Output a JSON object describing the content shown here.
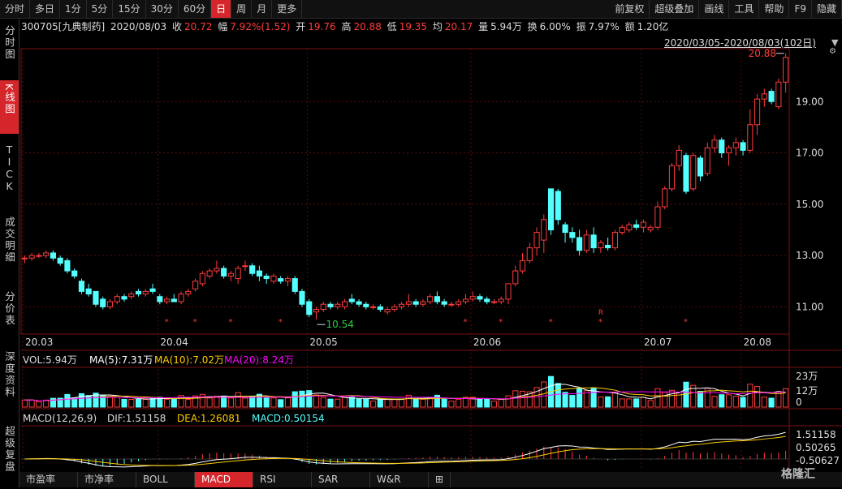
{
  "toolbar": {
    "left": [
      "分时",
      "多日",
      "1分",
      "5分",
      "15分",
      "30分",
      "60分",
      "日",
      "周",
      "月",
      "更多"
    ],
    "active": "日",
    "right": [
      "前复权",
      "超级叠加",
      "画线",
      "工具",
      "帮助",
      "F9",
      "隐藏"
    ]
  },
  "sidebar": {
    "items": [
      "分时图",
      "K线图",
      "TICK",
      "成交明细",
      "分价表",
      "深度资料",
      "超级复盘"
    ],
    "active": "K线图"
  },
  "info": {
    "code": "300705[九典制药]",
    "date": "2020/08/03",
    "close_label": "收",
    "close": "20.72",
    "chg_label": "幅",
    "chg": "7.92%(1.52)",
    "open_label": "开",
    "open": "19.76",
    "high_label": "高",
    "high": "20.88",
    "low_label": "低",
    "low": "19.35",
    "avg_label": "均",
    "avg": "20.17",
    "vol_label": "量",
    "vol": "5.94万",
    "turn_label": "换",
    "turn": "6.00%",
    "amp_label": "振",
    "amp": "7.97%",
    "amt_label": "额",
    "amt": "1.20亿"
  },
  "range": "2020/03/05-2020/08/03(102日)",
  "main_chart": {
    "type": "candlestick",
    "y_ticks": [
      "19.00",
      "17.00",
      "15.00",
      "13.00",
      "11.00"
    ],
    "x_ticks": [
      "20.03",
      "20.04",
      "20.05",
      "20.06",
      "20.07",
      "20.08"
    ],
    "high_label": "20.88",
    "low_label": "10.54",
    "r_marker": "R"
  },
  "vol_legend": {
    "name": "VOL:5.94万",
    "ma5": "MA(5):7.31万",
    "ma10": "MA(10):7.02万",
    "ma20": "MA(20):8.24万"
  },
  "vol_axis": [
    "23万",
    "12万",
    "0"
  ],
  "macd_legend": {
    "name": "MACD(12,26,9)",
    "dif": "DIF:1.51158",
    "dea": "DEA:1.26081",
    "macd": "MACD:0.50154"
  },
  "macd_axis": [
    "1.51158",
    "0.50265",
    "-0.50627"
  ],
  "bottom_tabs": [
    "市盈率",
    "市净率",
    "BOLL",
    "MACD",
    "RSI",
    "SAR",
    "W&R"
  ],
  "bottom_active": "MACD",
  "logo": "格隆汇",
  "colors": {
    "up": "#ff3b3b",
    "down": "#54ffff",
    "ma5": "#ffffff",
    "ma10": "#ffcc00",
    "ma20": "#ff00ff",
    "accent": "#d4262b"
  },
  "chart_data": {
    "type": "candlestick",
    "ohlc": [
      [
        12.9,
        13.0,
        12.7,
        12.9
      ],
      [
        12.9,
        13.1,
        12.8,
        13.0
      ],
      [
        13.0,
        13.1,
        12.9,
        13.0
      ],
      [
        13.0,
        13.2,
        12.9,
        13.1
      ],
      [
        13.1,
        13.2,
        12.8,
        12.9
      ],
      [
        12.9,
        13.0,
        12.6,
        12.7
      ],
      [
        12.8,
        12.9,
        12.3,
        12.4
      ],
      [
        12.4,
        12.5,
        12.1,
        12.2
      ],
      [
        12.0,
        12.1,
        11.5,
        11.6
      ],
      [
        11.7,
        11.9,
        11.4,
        11.5
      ],
      [
        11.6,
        11.6,
        11.0,
        11.1
      ],
      [
        11.3,
        11.4,
        10.9,
        11.0
      ],
      [
        11.0,
        11.3,
        10.9,
        11.2
      ],
      [
        11.2,
        11.5,
        11.1,
        11.4
      ],
      [
        11.4,
        11.5,
        11.2,
        11.3
      ],
      [
        11.4,
        11.6,
        11.3,
        11.5
      ],
      [
        11.6,
        11.7,
        11.4,
        11.5
      ],
      [
        11.5,
        11.7,
        11.4,
        11.6
      ],
      [
        11.7,
        11.9,
        11.5,
        11.6
      ],
      [
        11.4,
        11.5,
        11.1,
        11.2
      ],
      [
        11.2,
        11.4,
        11.1,
        11.3
      ],
      [
        11.3,
        11.5,
        11.2,
        11.2
      ],
      [
        11.2,
        11.6,
        11.1,
        11.5
      ],
      [
        11.5,
        11.7,
        11.4,
        11.6
      ],
      [
        11.7,
        12.1,
        11.6,
        12.0
      ],
      [
        11.9,
        12.4,
        11.8,
        12.3
      ],
      [
        12.2,
        12.5,
        12.1,
        12.4
      ],
      [
        12.4,
        12.8,
        12.3,
        12.5
      ],
      [
        12.5,
        12.6,
        12.1,
        12.2
      ],
      [
        12.2,
        12.4,
        12.0,
        12.3
      ],
      [
        12.1,
        12.6,
        11.9,
        12.5
      ],
      [
        12.6,
        12.8,
        12.4,
        12.6
      ],
      [
        12.6,
        12.7,
        12.2,
        12.3
      ],
      [
        12.4,
        12.6,
        12.0,
        12.2
      ],
      [
        12.2,
        12.3,
        11.9,
        12.1
      ],
      [
        12.0,
        12.3,
        11.9,
        12.2
      ],
      [
        12.1,
        12.2,
        11.9,
        12.0
      ],
      [
        12.0,
        12.2,
        11.8,
        12.1
      ],
      [
        12.1,
        12.2,
        11.5,
        11.6
      ],
      [
        11.6,
        11.7,
        11.0,
        11.1
      ],
      [
        11.2,
        11.3,
        10.6,
        10.7
      ],
      [
        10.8,
        11.0,
        10.5,
        10.9
      ],
      [
        10.9,
        11.2,
        10.8,
        11.1
      ],
      [
        11.1,
        11.2,
        10.9,
        11.0
      ],
      [
        11.0,
        11.2,
        10.9,
        11.1
      ],
      [
        11.0,
        11.3,
        10.9,
        11.2
      ],
      [
        11.3,
        11.5,
        11.1,
        11.2
      ],
      [
        11.2,
        11.3,
        11.0,
        11.1
      ],
      [
        11.1,
        11.2,
        10.9,
        11.0
      ],
      [
        11.0,
        11.1,
        10.9,
        11.0
      ],
      [
        11.0,
        11.1,
        10.8,
        10.9
      ],
      [
        10.8,
        11.0,
        10.7,
        10.9
      ],
      [
        10.9,
        11.1,
        10.8,
        11.0
      ],
      [
        11.0,
        11.2,
        10.9,
        11.1
      ],
      [
        11.1,
        11.5,
        11.0,
        11.2
      ],
      [
        11.2,
        11.3,
        11.0,
        11.1
      ],
      [
        11.1,
        11.3,
        11.0,
        11.2
      ],
      [
        11.2,
        11.5,
        11.1,
        11.4
      ],
      [
        11.4,
        11.6,
        11.1,
        11.2
      ],
      [
        11.2,
        11.3,
        11.0,
        11.1
      ],
      [
        11.1,
        11.2,
        11.0,
        11.1
      ],
      [
        11.1,
        11.3,
        11.0,
        11.2
      ],
      [
        11.2,
        11.5,
        11.1,
        11.3
      ],
      [
        11.3,
        11.6,
        11.2,
        11.4
      ],
      [
        11.4,
        11.5,
        11.2,
        11.3
      ],
      [
        11.3,
        11.4,
        11.1,
        11.2
      ],
      [
        11.2,
        11.3,
        11.1,
        11.2
      ],
      [
        11.2,
        11.4,
        11.1,
        11.3
      ],
      [
        11.3,
        11.6,
        11.1,
        11.9
      ],
      [
        11.9,
        12.6,
        11.8,
        12.4
      ],
      [
        12.4,
        13.1,
        12.3,
        12.8
      ],
      [
        12.8,
        13.5,
        12.7,
        13.3
      ],
      [
        13.3,
        14.1,
        13.0,
        13.9
      ],
      [
        13.6,
        14.6,
        13.1,
        14.4
      ],
      [
        15.6,
        15.6,
        13.8,
        14.0
      ],
      [
        15.5,
        15.6,
        14.2,
        14.4
      ],
      [
        14.2,
        14.3,
        13.5,
        13.9
      ],
      [
        13.9,
        14.1,
        13.5,
        13.7
      ],
      [
        13.7,
        14.0,
        13.0,
        13.2
      ],
      [
        13.2,
        14.0,
        13.1,
        13.8
      ],
      [
        13.8,
        14.1,
        13.1,
        13.3
      ],
      [
        13.3,
        13.6,
        13.1,
        13.5
      ],
      [
        13.4,
        13.7,
        13.2,
        13.3
      ],
      [
        13.3,
        14.0,
        13.2,
        13.9
      ],
      [
        13.9,
        14.2,
        13.8,
        14.1
      ],
      [
        14.0,
        14.3,
        13.9,
        14.2
      ],
      [
        14.2,
        14.4,
        14.0,
        14.1
      ],
      [
        14.1,
        14.4,
        13.9,
        14.3
      ],
      [
        14.0,
        14.2,
        13.9,
        14.1
      ],
      [
        14.1,
        15.1,
        14.0,
        14.9
      ],
      [
        14.9,
        15.7,
        14.8,
        15.6
      ],
      [
        15.6,
        16.6,
        15.5,
        16.5
      ],
      [
        16.5,
        17.3,
        16.3,
        17.1
      ],
      [
        16.9,
        17.0,
        15.4,
        15.5
      ],
      [
        15.6,
        17.0,
        15.5,
        16.9
      ],
      [
        16.8,
        16.9,
        15.9,
        16.1
      ],
      [
        16.2,
        17.4,
        16.1,
        17.2
      ],
      [
        17.2,
        17.7,
        17.0,
        17.5
      ],
      [
        17.5,
        17.6,
        16.8,
        17.0
      ],
      [
        17.0,
        17.3,
        16.5,
        17.2
      ],
      [
        17.2,
        17.6,
        16.9,
        17.4
      ],
      [
        17.4,
        17.5,
        16.9,
        17.1
      ],
      [
        17.1,
        18.7,
        17.0,
        18.1
      ],
      [
        18.1,
        19.3,
        17.7,
        19.1
      ],
      [
        19.1,
        19.5,
        18.8,
        19.3
      ],
      [
        19.4,
        19.5,
        18.9,
        19.0
      ],
      [
        18.8,
        19.9,
        18.7,
        19.76
      ],
      [
        19.76,
        20.88,
        19.35,
        20.72
      ]
    ],
    "y_range": [
      10.0,
      21.0
    ]
  }
}
